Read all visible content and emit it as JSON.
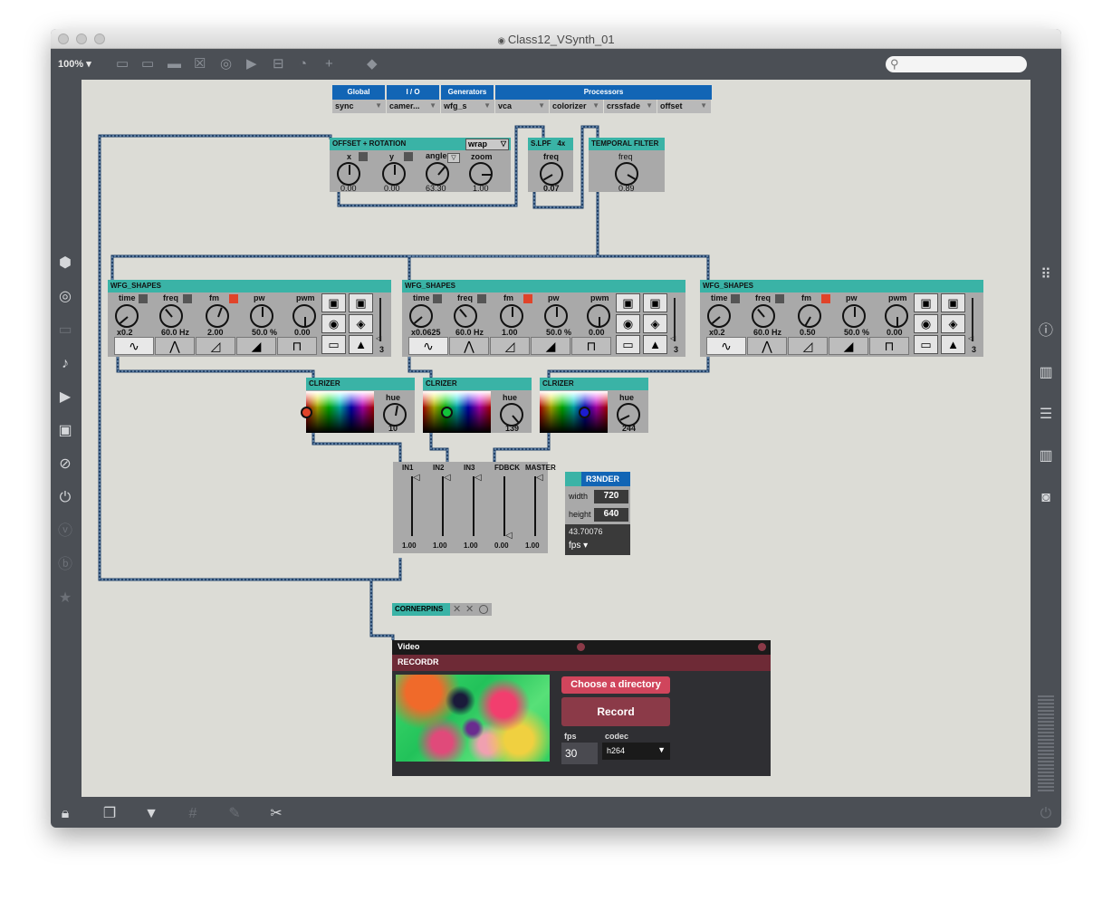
{
  "window": {
    "title": "Class12_VSynth_01"
  },
  "toolbar": {
    "zoom": "100% ▾",
    "search_placeholder": ""
  },
  "menu": {
    "groups": [
      "Global",
      "I / O",
      "Generators",
      "Processors"
    ],
    "items": [
      {
        "label": "sync"
      },
      {
        "label": "camer..."
      },
      {
        "label": "wfg_s"
      },
      {
        "label": "vca"
      },
      {
        "label": "colorizer"
      },
      {
        "label": "crssfade"
      },
      {
        "label": "offset"
      }
    ]
  },
  "offset_rotation": {
    "title": "OFFSET + ROTATION",
    "mode": "wrap",
    "params": [
      {
        "label": "x",
        "value": "0.00"
      },
      {
        "label": "y",
        "value": "0.00"
      },
      {
        "label": "angle",
        "value": "63.30"
      },
      {
        "label": "zoom",
        "value": "1.00"
      }
    ]
  },
  "slpf": {
    "title": "S.LPF",
    "badge": "4x",
    "label": "freq",
    "value": "0.07"
  },
  "temporal": {
    "title": "TEMPORAL FILTER",
    "label": "freq",
    "value": "0.89"
  },
  "wfg_labels": [
    "time",
    "freq",
    "fm",
    "pw",
    "pwm"
  ],
  "wfg": [
    {
      "title": "WFG_SHAPES",
      "values": [
        "x0.2",
        "60.0 Hz",
        "2.00",
        "50.0 %",
        "0.00"
      ],
      "count": "3"
    },
    {
      "title": "WFG_SHAPES",
      "values": [
        "x0.0625",
        "60.0 Hz",
        "1.00",
        "50.0 %",
        "0.00"
      ],
      "count": "3"
    },
    {
      "title": "WFG_SHAPES",
      "values": [
        "x0.2",
        "60.0 Hz",
        "0.50",
        "50.0 %",
        "0.00"
      ],
      "count": "3"
    }
  ],
  "clrizer": [
    {
      "title": "CLRIZER",
      "label": "hue",
      "value": "10",
      "ring_color": "#e0442a"
    },
    {
      "title": "CLRIZER",
      "label": "hue",
      "value": "139",
      "ring_color": "#12c23a"
    },
    {
      "title": "CLRIZER",
      "label": "hue",
      "value": "244",
      "ring_color": "#1c1ccf"
    }
  ],
  "mixer": {
    "channels": [
      {
        "label": "IN1",
        "value": "1.00",
        "level": 1.0
      },
      {
        "label": "IN2",
        "value": "1.00",
        "level": 1.0
      },
      {
        "label": "IN3",
        "value": "1.00",
        "level": 1.0
      },
      {
        "label": "FDBCK",
        "value": "0.00",
        "level": 0.0
      },
      {
        "label": "MASTER",
        "value": "1.00",
        "level": 1.0
      }
    ]
  },
  "render": {
    "title": "R3NDER",
    "width_label": "width",
    "width_value": "720",
    "height_label": "height",
    "height_value": "640",
    "fps_readout": "43.70076",
    "fps_unit": "fps ▾"
  },
  "cornerpins": {
    "title": "CORNERPINS"
  },
  "video": {
    "title": "Video",
    "recorder_title": "RECORDR",
    "choose_label": "Choose a directory",
    "record_label": "Record",
    "fps_label": "fps",
    "fps_value": "30",
    "codec_label": "codec",
    "codec_value": "h264"
  },
  "colors": {
    "accent": "#3ab3a6",
    "menu_blue": "#1265b5",
    "record": "#8b3a48"
  }
}
